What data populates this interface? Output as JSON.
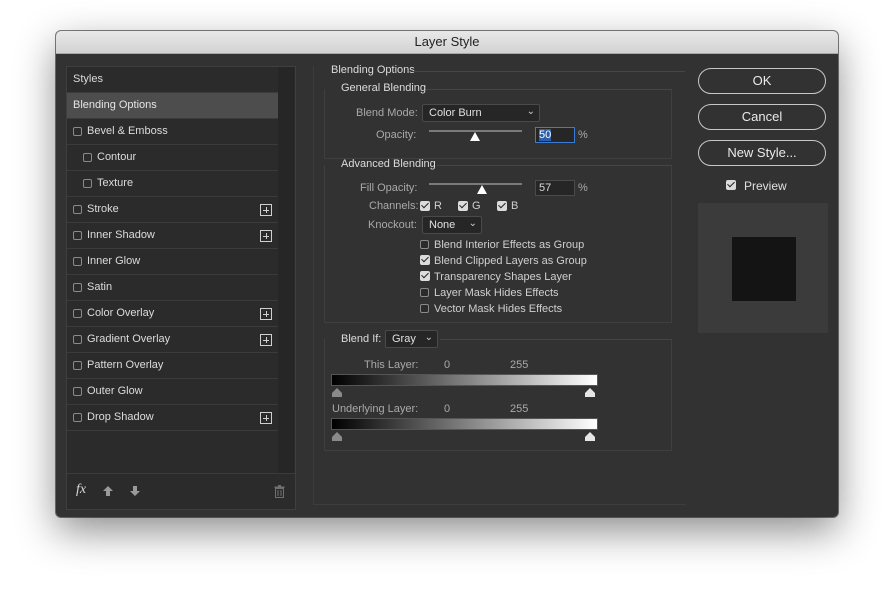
{
  "window": {
    "title": "Layer Style"
  },
  "styles_panel": {
    "items": [
      {
        "label": "Styles"
      },
      {
        "label": "Blending Options"
      },
      {
        "label": "Bevel & Emboss"
      },
      {
        "label": "Contour"
      },
      {
        "label": "Texture"
      },
      {
        "label": "Stroke"
      },
      {
        "label": "Inner Shadow"
      },
      {
        "label": "Inner Glow"
      },
      {
        "label": "Satin"
      },
      {
        "label": "Color Overlay"
      },
      {
        "label": "Gradient Overlay"
      },
      {
        "label": "Pattern Overlay"
      },
      {
        "label": "Outer Glow"
      },
      {
        "label": "Drop Shadow"
      }
    ],
    "footer": {
      "fx_label": "fx"
    }
  },
  "blending_options": {
    "section_title": "Blending Options",
    "general": {
      "title": "General Blending",
      "blend_mode_label": "Blend Mode:",
      "blend_mode_value": "Color Burn",
      "opacity_label": "Opacity:",
      "opacity_value": "50",
      "opacity_unit": "%"
    },
    "advanced": {
      "title": "Advanced Blending",
      "fill_opacity_label": "Fill Opacity:",
      "fill_opacity_value": "57",
      "fill_opacity_unit": "%",
      "channels_label": "Channels:",
      "channel_r": "R",
      "channel_g": "G",
      "channel_b": "B",
      "knockout_label": "Knockout:",
      "knockout_value": "None",
      "options": [
        {
          "label": "Blend Interior Effects as Group",
          "checked": false
        },
        {
          "label": "Blend Clipped Layers as Group",
          "checked": true
        },
        {
          "label": "Transparency Shapes Layer",
          "checked": true
        },
        {
          "label": "Layer Mask Hides Effects",
          "checked": false
        },
        {
          "label": "Vector Mask Hides Effects",
          "checked": false
        }
      ]
    },
    "blend_if": {
      "label": "Blend If:",
      "value": "Gray",
      "this_layer_label": "This Layer:",
      "this_layer_low": "0",
      "this_layer_high": "255",
      "underlying_label": "Underlying Layer:",
      "underlying_low": "0",
      "underlying_high": "255"
    }
  },
  "buttons": {
    "ok": "OK",
    "cancel": "Cancel",
    "new_style": "New Style..."
  },
  "preview": {
    "label": "Preview",
    "checked": true
  }
}
